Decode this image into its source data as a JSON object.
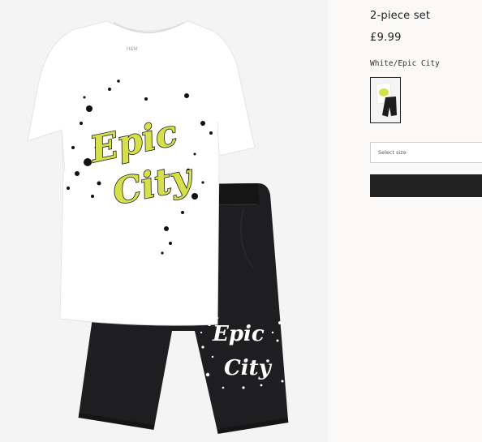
{
  "product": {
    "title": "2-piece set",
    "price": "£9.99",
    "color_name": "White/Epic City",
    "swatch_alt": "White/Epic City swatch",
    "size_select_placeholder": "Select size",
    "add_button_label": ""
  },
  "graphics": {
    "shirt_print_text": "Epic City",
    "shorts_print_text": "Epic City",
    "shirt_label": "H&M",
    "print_color": "#d6e04a",
    "shirt_color": "#ffffff",
    "shorts_color": "#1e1e20"
  }
}
